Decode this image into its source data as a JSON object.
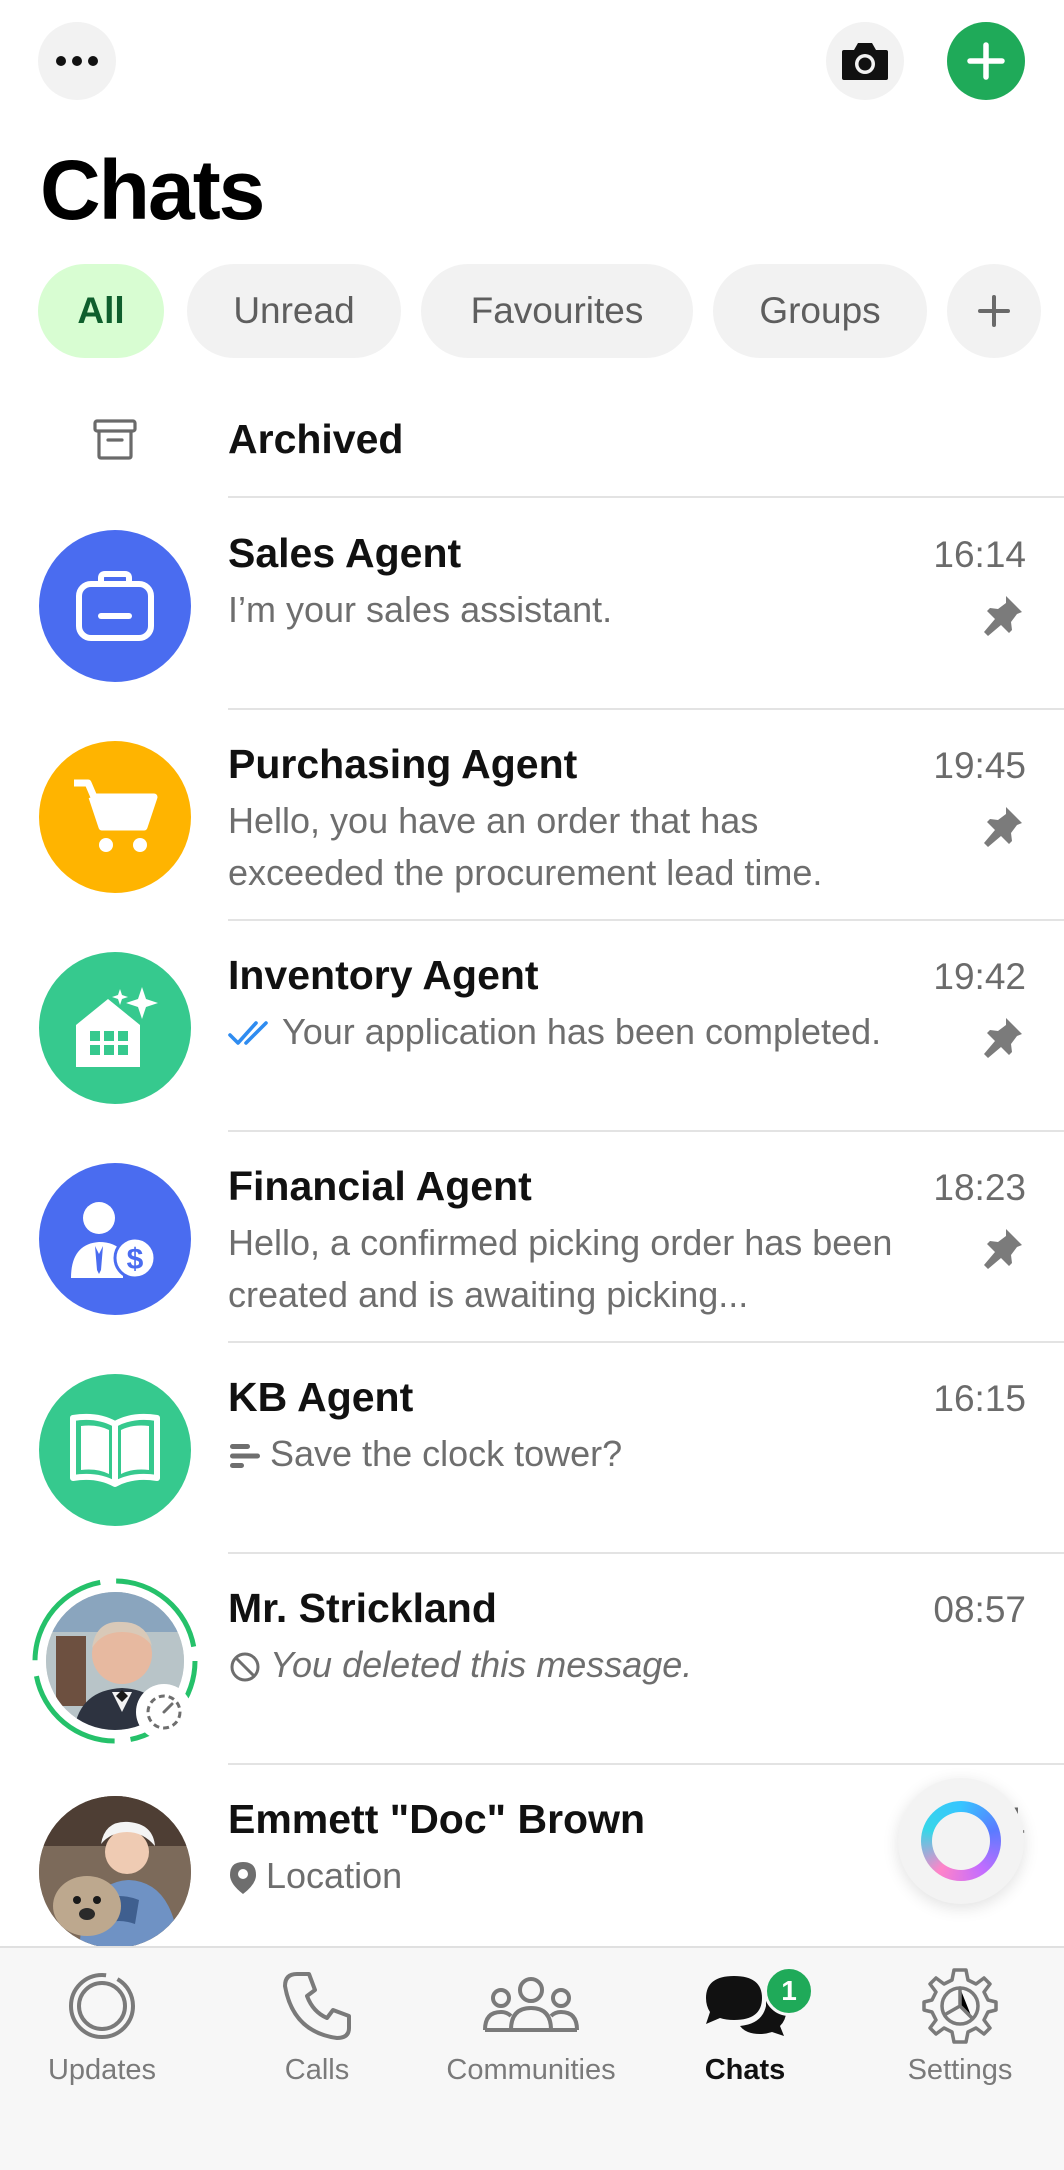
{
  "header": {
    "title": "Chats",
    "more_icon": "more-horizontal-icon",
    "camera_icon": "camera-icon",
    "new_chat_icon": "plus-icon",
    "accent": "#1faa59"
  },
  "filters": [
    {
      "label": "All",
      "active": true
    },
    {
      "label": "Unread",
      "active": false
    },
    {
      "label": "Favourites",
      "active": false
    },
    {
      "label": "Groups",
      "active": false
    }
  ],
  "archived": {
    "label": "Archived"
  },
  "chats": [
    {
      "name": "Sales Agent",
      "time": "16:14",
      "preview": "I’m your sales assistant.",
      "pinned": true,
      "avatar_color": "#4a6cf0"
    },
    {
      "name": "Purchasing Agent",
      "time": "19:45",
      "preview": "Hello, you have an order that has exceeded the procurement lead time.",
      "pinned": true,
      "avatar_color": "#ffb400"
    },
    {
      "name": "Inventory Agent",
      "time": "19:42",
      "preview": "Your application has been completed.",
      "pinned": true,
      "avatar_color": "#36c98e"
    },
    {
      "name": "Financial Agent",
      "time": "18:23",
      "preview": "Hello, a confirmed picking order has been created and is awaiting picking...",
      "pinned": true,
      "avatar_color": "#4a6cf0"
    },
    {
      "name": "KB Agent",
      "time": "16:15",
      "preview": "Save the clock tower?",
      "pinned": false,
      "avatar_color": "#36c98e"
    },
    {
      "name": "Mr. Strickland",
      "time": "08:57",
      "preview": "You deleted this message.",
      "pinned": false
    },
    {
      "name": "Emmett \"Doc\" Brown",
      "time": "1",
      "preview": "Location",
      "pinned": false
    }
  ],
  "tabbar": {
    "tabs": [
      {
        "label": "Updates"
      },
      {
        "label": "Calls"
      },
      {
        "label": "Communities"
      },
      {
        "label": "Chats",
        "badge": "1"
      },
      {
        "label": "Settings"
      }
    ]
  }
}
